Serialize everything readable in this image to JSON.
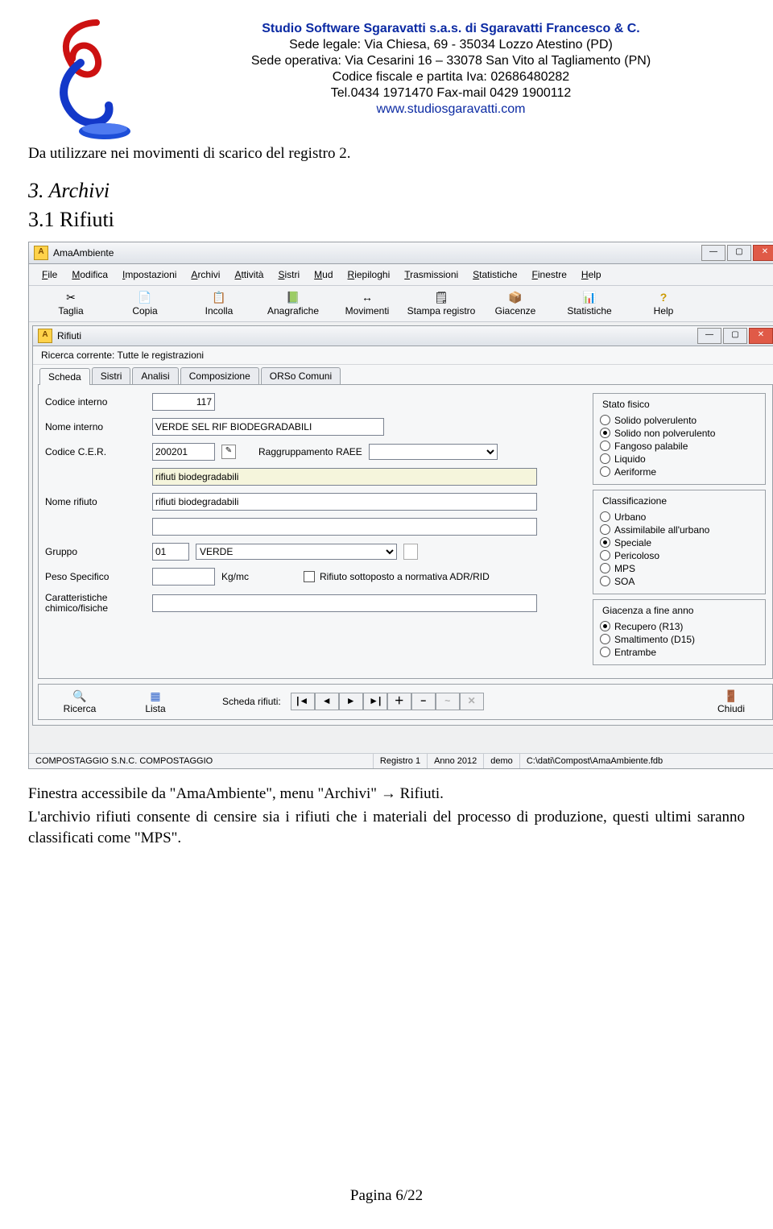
{
  "header": {
    "title": "Studio Software Sgaravatti s.a.s. di Sgaravatti Francesco & C.",
    "line1": "Sede legale: Via Chiesa, 69 - 35034 Lozzo Atestino (PD)",
    "line2": "Sede operativa: Via Cesarini 16 – 33078 San Vito al Tagliamento (PN)",
    "line3": "Codice fiscale e partita Iva: 02686480282",
    "line4": "Tel.0434 1971470 Fax-mail 0429 1900112",
    "link": "www.studiosgaravatti.com"
  },
  "body": {
    "intro": "Da utilizzare nei movimenti di scarico del registro 2.",
    "h3": "3. Archivi",
    "h4": "3.1 Rifiuti",
    "after1": "Finestra accessibile da \"AmaAmbiente\",  menu \"Archivi\" → Rifiuti.",
    "after2": "L'archivio rifiuti consente di censire sia i rifiuti che i materiali del processo di produzione, questi ultimi saranno classificati come \"MPS\"."
  },
  "footer": "Pagina 6/22",
  "app": {
    "main_title": "AmaAmbiente",
    "menus": [
      "File",
      "Modifica",
      "Impostazioni",
      "Archivi",
      "Attività",
      "Sistri",
      "Mud",
      "Riepiloghi",
      "Trasmissioni",
      "Statistiche",
      "Finestre",
      "Help"
    ],
    "toolbar": [
      {
        "icon": "✂",
        "label": "Taglia"
      },
      {
        "icon": "📄",
        "label": "Copia"
      },
      {
        "icon": "📋",
        "label": "Incolla"
      },
      {
        "icon": "📗",
        "label": "Anagrafiche"
      },
      {
        "icon": "↔",
        "label": "Movimenti"
      },
      {
        "icon": "🗒",
        "label": "Stampa registro"
      },
      {
        "icon": "📦",
        "label": "Giacenze"
      },
      {
        "icon": "📊",
        "label": "Statistiche"
      },
      {
        "icon": "?",
        "label": "Help"
      }
    ],
    "sub_title": "Rifiuti",
    "search_line": "Ricerca corrente: Tutte le registrazioni",
    "tabs": [
      "Scheda",
      "Sistri",
      "Analisi",
      "Composizione",
      "ORSo Comuni"
    ],
    "form": {
      "codice_interno_label": "Codice interno",
      "codice_interno_value": "117",
      "nome_interno_label": "Nome interno",
      "nome_interno_value": "VERDE SEL RIF BIODEGRADABILI",
      "codice_cer_label": "Codice C.E.R.",
      "codice_cer_value": "200201",
      "raggruppamento_label": "Raggruppamento RAEE",
      "desc_value": "rifiuti biodegradabili",
      "nome_rifiuto_label": "Nome rifiuto",
      "nome_rifiuto_value": "rifiuti biodegradabili",
      "gruppo_label": "Gruppo",
      "gruppo_code": "01",
      "gruppo_name": "VERDE",
      "peso_label": "Peso Specifico",
      "peso_unit": "Kg/mc",
      "adr_label": "Rifiuto sottoposto a normativa  ADR/RID",
      "caratt_label": "Caratteristiche chimico/fisiche"
    },
    "stato_fisico": {
      "title": "Stato fisico",
      "options": [
        "Solido polverulento",
        "Solido non polverulento",
        "Fangoso palabile",
        "Liquido",
        "Aeriforme"
      ],
      "selected": 1
    },
    "classificazione": {
      "title": "Classificazione",
      "options": [
        "Urbano",
        "Assimilabile all'urbano",
        "Speciale",
        "Pericoloso",
        "MPS",
        "SOA"
      ],
      "selected": 2
    },
    "giacenza": {
      "title": "Giacenza a fine anno",
      "options": [
        "Recupero (R13)",
        "Smaltimento (D15)",
        "Entrambe"
      ],
      "selected": 0
    },
    "nav": {
      "ricerca": "Ricerca",
      "lista": "Lista",
      "scheda_label": "Scheda rifiuti:",
      "chiudi": "Chiudi"
    },
    "status": {
      "c1": "COMPOSTAGGIO  S.N.C. COMPOSTAGGIO",
      "c2": "Registro 1",
      "c3": "Anno 2012",
      "c4": "demo",
      "c5": "C:\\dati\\Compost\\AmaAmbiente.fdb"
    }
  }
}
